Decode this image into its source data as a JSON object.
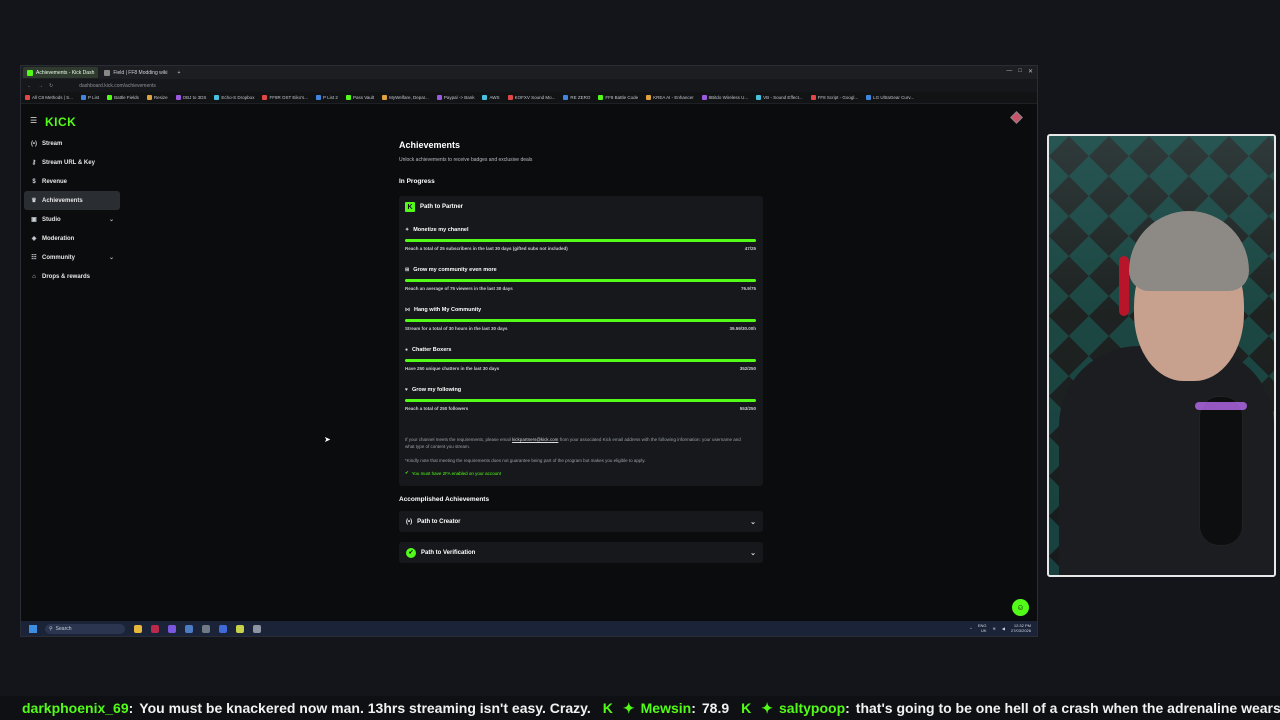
{
  "browser": {
    "tabs": [
      {
        "title": "Achievements - Kick Dash",
        "active": true
      },
      {
        "title": "Field | FF8 Modding wiki",
        "active": false
      }
    ],
    "url": "dashboard.kick.com/achievements",
    "bookmarks": [
      "All C8 Methods | S...",
      "P List",
      "Battle Fields",
      "Resize",
      "OBJ to 3DS",
      "Echo-S Dropbox",
      "FF8R OST Eiko's...",
      "P List 2",
      "Pass Vault",
      "MyWelfare, Depar...",
      "Paypal -> Bank",
      "AWS",
      "KOFXV Sound Mo...",
      "RE ZERO",
      "FF8 Battle Code",
      "KREA AI - Enhancer",
      "8Bitdo Wireless U...",
      "VB - Sound Effect...",
      "FF8 Script - Googl...",
      "LG UltraGear Curv..."
    ]
  },
  "app": {
    "logo": "KICK",
    "sidebar": [
      {
        "label": "Stream",
        "icon": "broadcast-icon",
        "glyph": "(•)",
        "active": false,
        "expandable": false
      },
      {
        "label": "Stream URL & Key",
        "icon": "key-icon",
        "glyph": "⚷",
        "active": false,
        "expandable": false
      },
      {
        "label": "Revenue",
        "icon": "dollar-icon",
        "glyph": "$",
        "active": false,
        "expandable": false
      },
      {
        "label": "Achievements",
        "icon": "trophy-icon",
        "glyph": "♛",
        "active": true,
        "expandable": false
      },
      {
        "label": "Studio",
        "icon": "studio-icon",
        "glyph": "▣",
        "active": false,
        "expandable": true
      },
      {
        "label": "Moderation",
        "icon": "shield-icon",
        "glyph": "◈",
        "active": false,
        "expandable": false
      },
      {
        "label": "Community",
        "icon": "people-icon",
        "glyph": "☷",
        "active": false,
        "expandable": true
      },
      {
        "label": "Drops & rewards",
        "icon": "gift-icon",
        "glyph": "⌂",
        "active": false,
        "expandable": false
      }
    ],
    "page_title": "Achievements",
    "page_subtitle": "Unlock achievements to receive badges and exclusive deals",
    "in_progress_heading": "In Progress",
    "partner_card": {
      "title": "Path to Partner",
      "achievements": [
        {
          "name": "Monetize my channel",
          "icon": "sparkle-icon",
          "glyph": "✦",
          "description": "Reach a total of 25 subscribers in the last 30 days (gifted subs not included)",
          "value": "47/25",
          "progress": 1.0
        },
        {
          "name": "Grow my community even more",
          "icon": "community-icon",
          "glyph": "⊞",
          "description": "Reach an average of 75 viewers in the last 30 days",
          "value": "76.9/75",
          "progress": 1.0
        },
        {
          "name": "Hang with My Community",
          "icon": "hang-icon",
          "glyph": "⋈",
          "description": "Stream for a total of 30 hours in the last 30 days",
          "value": "39.59/30.00h",
          "progress": 1.0
        },
        {
          "name": "Chatter Boxers",
          "icon": "chat-bubble-icon",
          "glyph": "●",
          "description": "Have 250 unique chatters in the last 30 days",
          "value": "352/250",
          "progress": 1.0
        },
        {
          "name": "Grow my following",
          "icon": "heart-icon",
          "glyph": "♥",
          "description": "Reach a total of 250 followers",
          "value": "553/250",
          "progress": 1.0
        }
      ],
      "note_before": "If your channel meets the requirements, please email ",
      "note_email": "kickpartners@kick.com",
      "note_after": " from your associated Kick email address with the following information: your username and what type of content you stream.",
      "note2": "*Kindly note that meeting the requirements does not guarantee being part of the program but makes you eligible to apply.",
      "twofa": "You must have 2FA enabled on your account"
    },
    "accomplished_heading": "Accomplished Achievements",
    "accomplished": [
      {
        "title": "Path to Creator",
        "icon": "broadcast-icon",
        "glyph": "(•)"
      },
      {
        "title": "Path to Verification",
        "icon": "verified-icon",
        "glyph": "✔"
      }
    ]
  },
  "taskbar": {
    "search_placeholder": "Search",
    "lang": "ENG",
    "region": "UK",
    "time": "12:32 PM",
    "date": "27/03/2026"
  },
  "chat_ticker": [
    {
      "user": "darkphoenix_69",
      "message": "You must be knackered now man. 13hrs streaming isn't easy. Crazy."
    },
    {
      "user": "Mewsin",
      "message": "78.9"
    },
    {
      "user": "saltypoop",
      "message": "that's going to be one hell of a crash when the adrenaline wears off"
    }
  ],
  "colors": {
    "accent": "#53fc18",
    "background": "#0b0c0e",
    "card": "#16181b"
  }
}
